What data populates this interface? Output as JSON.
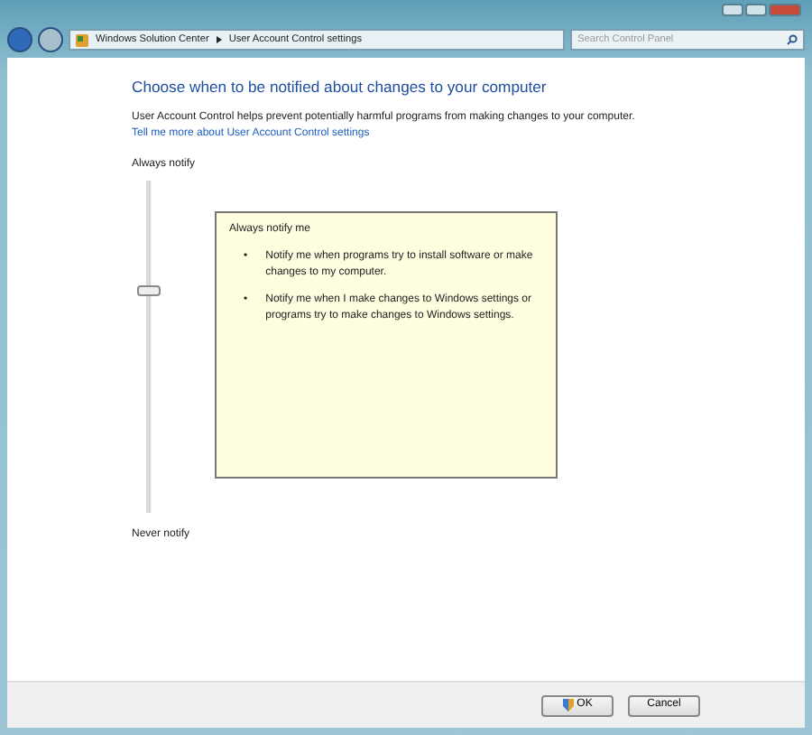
{
  "address_bar": {
    "crumbs": [
      "Windows Solution Center",
      "User Account Control settings"
    ]
  },
  "search": {
    "placeholder": "Search Control Panel"
  },
  "heading": "Choose when to be notified about changes to your computer",
  "description": "User Account Control helps prevent potentially harmful programs from making changes to your computer.",
  "link": "Tell me more about User Account Control settings",
  "slider": {
    "top_label": "Always notify",
    "bottom_label": "Never notify",
    "level": 0.667
  },
  "info": {
    "title": "Always notify me",
    "bullets": [
      {
        "marker": "•",
        "text": "Notify me when programs try to install software or make changes to my computer."
      },
      {
        "marker": "•",
        "text": "Notify me when I make changes to Windows settings or programs try to make changes to Windows settings."
      }
    ]
  },
  "buttons": [
    {
      "label": "OK",
      "kind": "shield"
    },
    {
      "label": "Cancel",
      "kind": "plain"
    }
  ]
}
